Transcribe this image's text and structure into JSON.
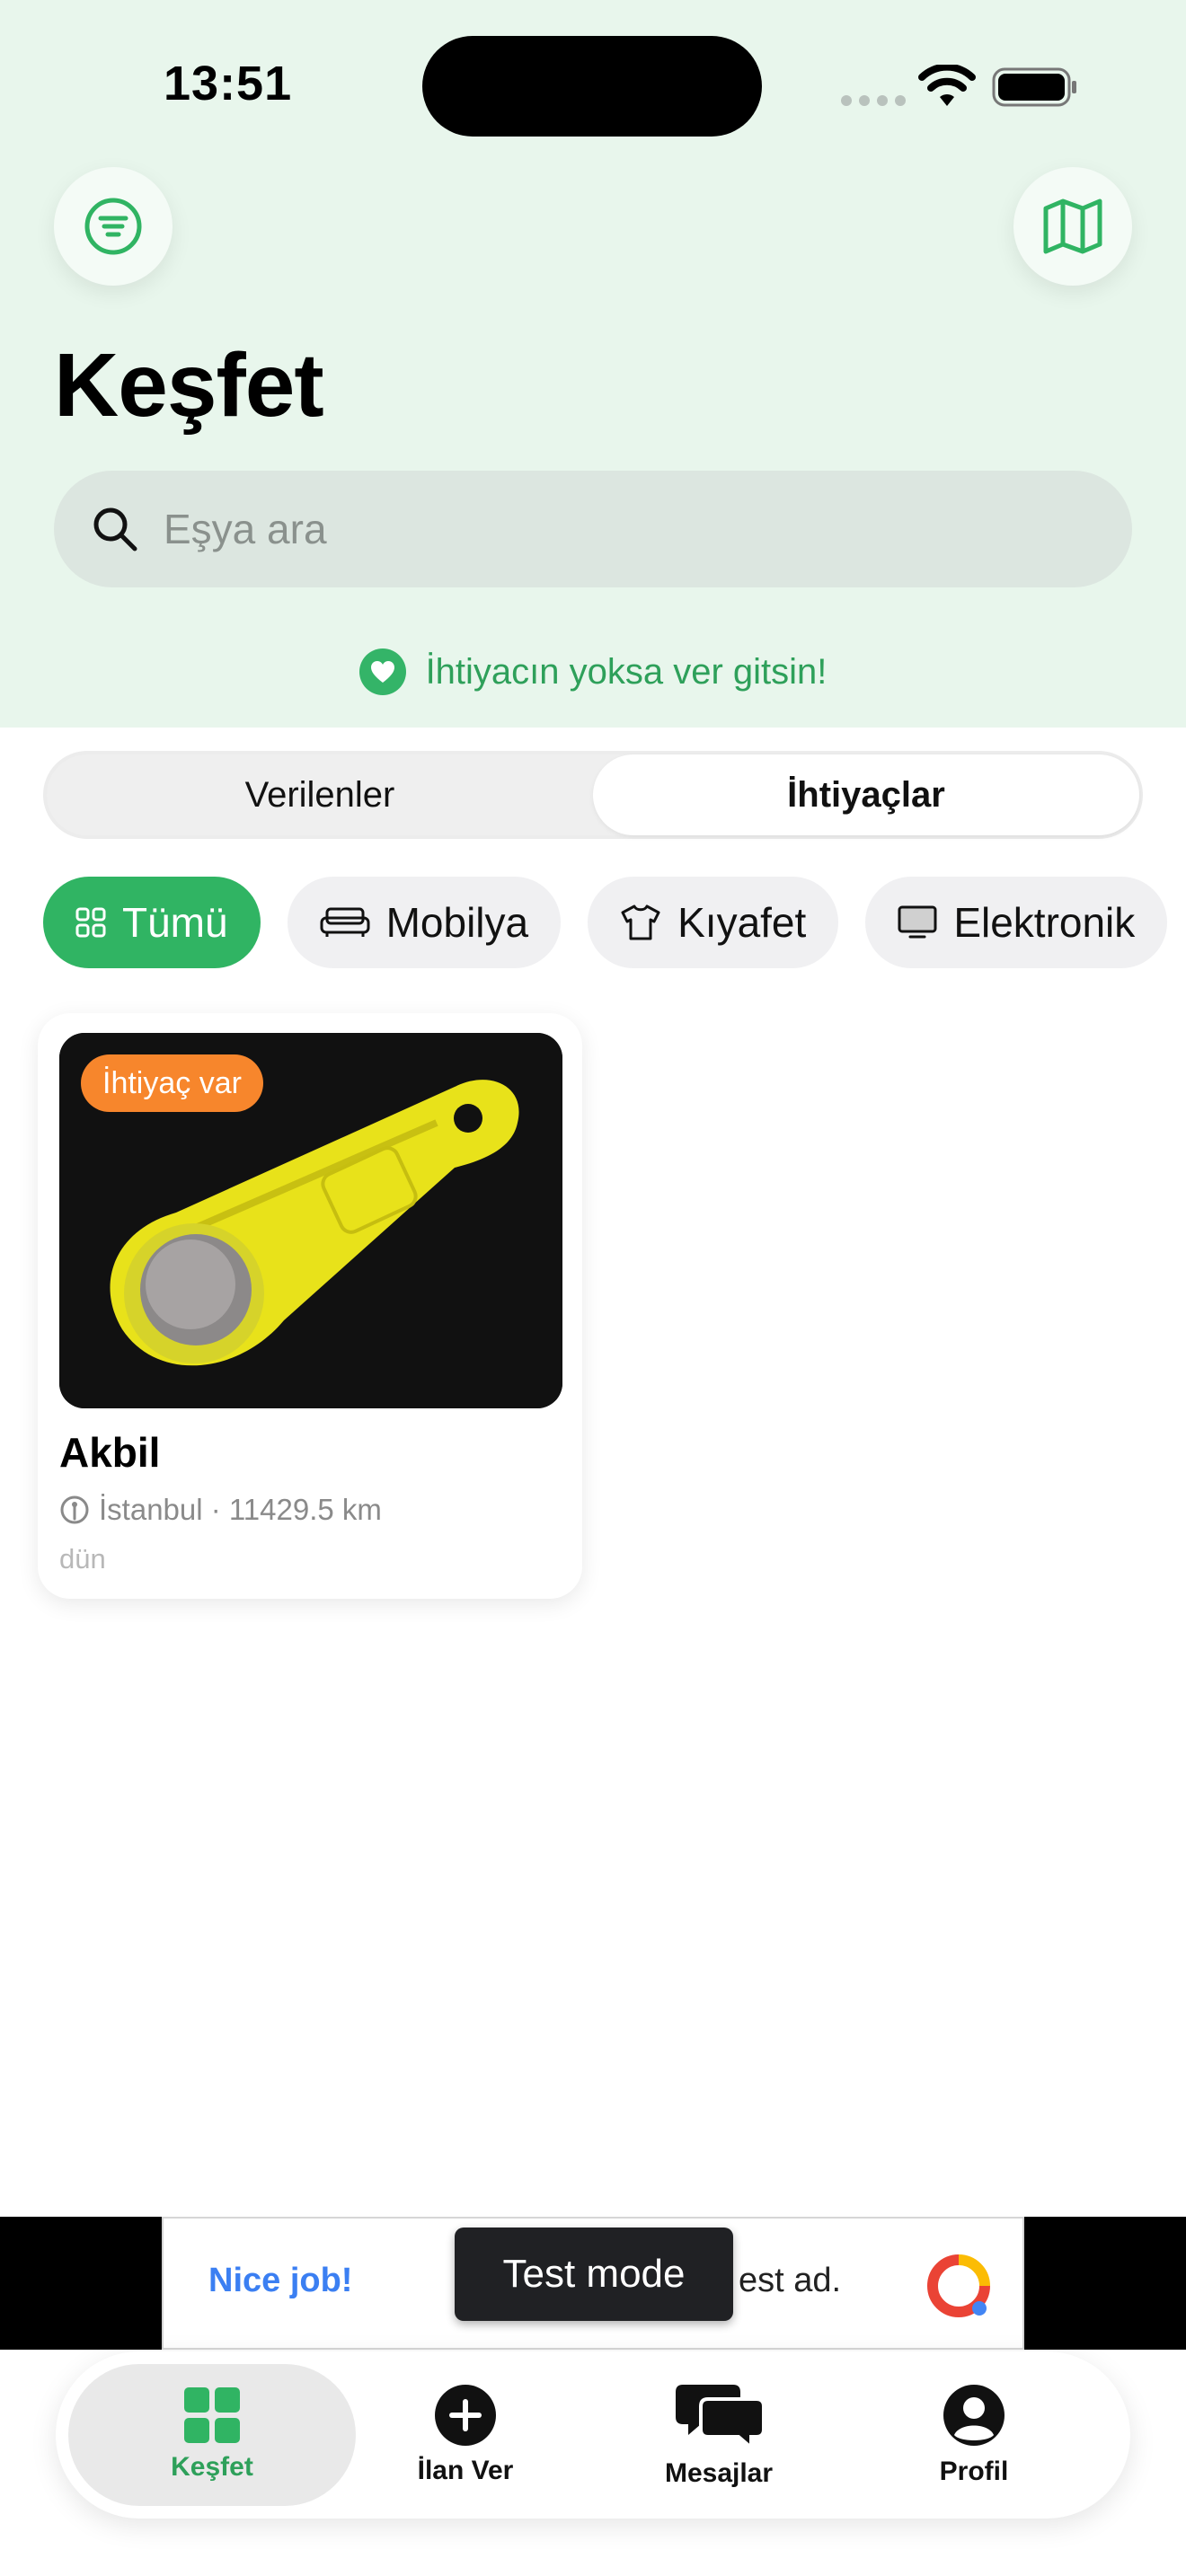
{
  "status_bar": {
    "time": "13:51"
  },
  "header": {
    "title": "Keşfet",
    "search_placeholder": "Eşya ara",
    "tagline": "İhtiyacın yoksa ver gitsin!"
  },
  "segments": [
    {
      "label": "Verilenler",
      "active": false
    },
    {
      "label": "İhtiyaçlar",
      "active": true
    }
  ],
  "categories": [
    {
      "label": "Tümü",
      "icon": "grid-icon",
      "active": true
    },
    {
      "label": "Mobilya",
      "icon": "sofa-icon",
      "active": false
    },
    {
      "label": "Kıyafet",
      "icon": "shirt-icon",
      "active": false
    },
    {
      "label": "Elektronik",
      "icon": "monitor-icon",
      "active": false
    }
  ],
  "listing": {
    "badge": "İhtiyaç var",
    "title": "Akbil",
    "location": "İstanbul · 11429.5 km",
    "time": "dün"
  },
  "ad": {
    "left_text": "Nice job!",
    "right_text": "est ad.",
    "tooltip": "Test mode"
  },
  "tabs": [
    {
      "label": "Keşfet",
      "icon": "grid-icon",
      "active": true
    },
    {
      "label": "İlan Ver",
      "icon": "plus-circle-icon",
      "active": false
    },
    {
      "label": "Mesajlar",
      "icon": "chat-bubbles-icon",
      "active": false
    },
    {
      "label": "Profil",
      "icon": "person-icon",
      "active": false
    }
  ],
  "colors": {
    "accent": "#30b463",
    "header_bg": "#e8f6ec",
    "badge": "#f7862c",
    "ad_link": "#3b7ff2"
  }
}
